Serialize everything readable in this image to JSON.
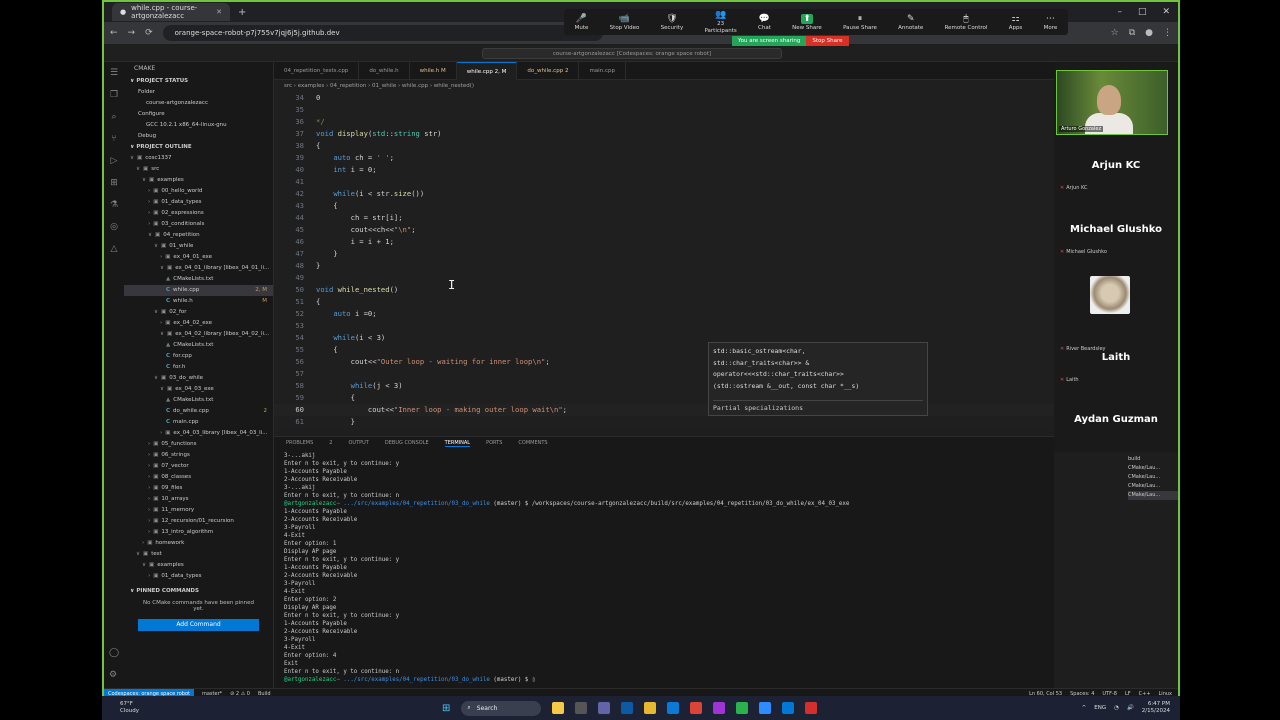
{
  "browser": {
    "tab_title": "while.cpp - course-artgonzalezacc",
    "url": "orange-space-robot-p7j755v7jqj6j5j.github.dev",
    "new_tab": "+",
    "minimize": "–",
    "maximize": "□",
    "close": "✕"
  },
  "zoom": {
    "buttons": [
      {
        "label": "Mute",
        "icon": "🎤"
      },
      {
        "label": "Stop Video",
        "icon": "📹"
      },
      {
        "label": "Security",
        "icon": "🛡"
      },
      {
        "label": "Participants",
        "icon": "👥",
        "count": "23"
      },
      {
        "label": "Chat",
        "icon": "💬"
      },
      {
        "label": "New Share",
        "icon": "⬆"
      },
      {
        "label": "Pause Share",
        "icon": "⏸"
      },
      {
        "label": "Annotate",
        "icon": "✎"
      },
      {
        "label": "Remote Control",
        "icon": "🖱"
      },
      {
        "label": "Apps",
        "icon": "⚏"
      },
      {
        "label": "More",
        "icon": "⋯"
      }
    ],
    "sharing_msg": "You are screen sharing",
    "stop_share": "Stop Share"
  },
  "vscode": {
    "command_center": "course-artgonzalezacc [Codespaces: orange space robot]",
    "sidebar_header": "CMAKE",
    "project_status": "PROJECT STATUS",
    "status_items": [
      "Folder",
      "course-artgonzalezacc",
      "Configure",
      "GCC 10.2.1 x86_64-linux-gnu",
      "Debug"
    ],
    "project_outline": "PROJECT OUTLINE",
    "tree": [
      {
        "label": "cosc1337",
        "indent": 6,
        "chev": "∨"
      },
      {
        "label": "src",
        "indent": 12,
        "chev": "∨"
      },
      {
        "label": "examples",
        "indent": 18,
        "chev": "∨"
      },
      {
        "label": "00_hello_world",
        "indent": 24,
        "chev": "›"
      },
      {
        "label": "01_data_types",
        "indent": 24,
        "chev": "›"
      },
      {
        "label": "02_expressions",
        "indent": 24,
        "chev": "›"
      },
      {
        "label": "03_conditionals",
        "indent": 24,
        "chev": "›"
      },
      {
        "label": "04_repetition",
        "indent": 24,
        "chev": "∨"
      },
      {
        "label": "01_while",
        "indent": 30,
        "chev": "∨"
      },
      {
        "label": "ex_04_01_exe",
        "indent": 36,
        "chev": "›"
      },
      {
        "label": "ex_04_01_library [libex_04_01_li...",
        "indent": 36,
        "chev": "∨"
      },
      {
        "label": "CMakeLists.txt",
        "indent": 42,
        "kind": "cmake"
      },
      {
        "label": "while.cpp",
        "indent": 42,
        "kind": "c",
        "badge": "2, M",
        "selected": true
      },
      {
        "label": "while.h",
        "indent": 42,
        "kind": "c",
        "badge": "M"
      },
      {
        "label": "02_for",
        "indent": 30,
        "chev": "∨"
      },
      {
        "label": "ex_04_02_exe",
        "indent": 36,
        "chev": "›"
      },
      {
        "label": "ex_04_02_library [libex_04_02_li...",
        "indent": 36,
        "chev": "∨"
      },
      {
        "label": "CMakeLists.txt",
        "indent": 42,
        "kind": "cmake"
      },
      {
        "label": "for.cpp",
        "indent": 42,
        "kind": "c"
      },
      {
        "label": "for.h",
        "indent": 42,
        "kind": "c"
      },
      {
        "label": "03_do_while",
        "indent": 30,
        "chev": "∨"
      },
      {
        "label": "ex_04_03_exe",
        "indent": 36,
        "chev": "∨"
      },
      {
        "label": "CMakeLists.txt",
        "indent": 42,
        "kind": "cmake"
      },
      {
        "label": "do_while.cpp",
        "indent": 42,
        "kind": "c",
        "badge": "2"
      },
      {
        "label": "main.cpp",
        "indent": 42,
        "kind": "c"
      },
      {
        "label": "ex_04_03_library [libex_04_03_li...",
        "indent": 36,
        "chev": "›"
      },
      {
        "label": "05_functions",
        "indent": 24,
        "chev": "›"
      },
      {
        "label": "06_strings",
        "indent": 24,
        "chev": "›"
      },
      {
        "label": "07_vector",
        "indent": 24,
        "chev": "›"
      },
      {
        "label": "08_classes",
        "indent": 24,
        "chev": "›"
      },
      {
        "label": "09_files",
        "indent": 24,
        "chev": "›"
      },
      {
        "label": "10_arrays",
        "indent": 24,
        "chev": "›"
      },
      {
        "label": "11_memory",
        "indent": 24,
        "chev": "›"
      },
      {
        "label": "12_recursion/01_recursion",
        "indent": 24,
        "chev": "›"
      },
      {
        "label": "13_intro_algorithm",
        "indent": 24,
        "chev": "›"
      },
      {
        "label": "homework",
        "indent": 18,
        "chev": "›"
      },
      {
        "label": "test",
        "indent": 12,
        "chev": "∨"
      },
      {
        "label": "examples",
        "indent": 18,
        "chev": "∨"
      },
      {
        "label": "01_data_types",
        "indent": 24,
        "chev": "›"
      }
    ],
    "pinned_commands": "PINNED COMMANDS",
    "pinned_note": "No CMake commands have been pinned yet.",
    "add_command": "Add Command",
    "editor_tabs": [
      {
        "label": "04_repetition_tests.cpp",
        "state": ""
      },
      {
        "label": "do_while.h",
        "state": ""
      },
      {
        "label": "while.h  M",
        "state": "mod"
      },
      {
        "label": "while.cpp  2, M",
        "state": "active"
      },
      {
        "label": "do_while.cpp  2",
        "state": "mod"
      },
      {
        "label": "main.cpp",
        "state": ""
      }
    ],
    "breadcrumbs": "src › examples › 04_repetition › 01_while › while.cpp › while_nested()",
    "hover_code": "std::basic_ostream<char,\nstd::char_traits<char>> &\noperator<<<std::char_traits<char>>\n(std::ostream &__out, const char *__s)",
    "hover_sub": "Partial specializations",
    "panel_tabs": [
      "PROBLEMS",
      "OUTPUT",
      "DEBUG CONSOLE",
      "TERMINAL",
      "PORTS",
      "COMMENTS"
    ],
    "problems_count": "2"
  },
  "terminal": [
    {
      "t": "3-...akij"
    },
    {
      "t": "Enter n to exit, y to continue: y"
    },
    {
      "t": "1-Accounts Payable"
    },
    {
      "t": "2-Accounts Receivable"
    },
    {
      "t": "3-...akij"
    },
    {
      "t": "Enter n to exit, y to continue: n"
    },
    {
      "prompt": true,
      "user": "@artgonzalezacc",
      "path": "→ .../src/examples/04_repetition/03_do_while",
      "branch": " (master)",
      "cmd": " $ /workspaces/course-artgonzalezacc/build/src/examples/04_repetition/03_do_while/ex_04_03_exe"
    },
    {
      "t": "1-Accounts Payable"
    },
    {
      "t": "2-Accounts Receivable"
    },
    {
      "t": "3-Payroll"
    },
    {
      "t": "4-Exit"
    },
    {
      "t": "Enter option: 1"
    },
    {
      "t": "Display AP page"
    },
    {
      "t": "Enter n to exit, y to continue: y"
    },
    {
      "t": "1-Accounts Payable"
    },
    {
      "t": "2-Accounts Receivable"
    },
    {
      "t": "3-Payroll"
    },
    {
      "t": "4-Exit"
    },
    {
      "t": "Enter option: 2"
    },
    {
      "t": "Display AR page"
    },
    {
      "t": "Enter n to exit, y to continue: y"
    },
    {
      "t": "1-Accounts Payable"
    },
    {
      "t": "2-Accounts Receivable"
    },
    {
      "t": "3-Payroll"
    },
    {
      "t": "4-Exit"
    },
    {
      "t": "Enter option: 4"
    },
    {
      "t": "Exit"
    },
    {
      "t": "Enter n to exit, y to continue: n"
    },
    {
      "prompt": true,
      "user": "@artgonzalezacc",
      "path": "→ .../src/examples/04_repetition/03_do_while",
      "branch": " (master)",
      "cmd": " $ ▯"
    }
  ],
  "meeting": {
    "host": "Arturo Gonzalez",
    "participants": [
      {
        "big": "Arjun KC",
        "small": "Arjun KC"
      },
      {
        "big": "Michael Glushko",
        "small": "Michael Glushko"
      },
      {
        "big": "",
        "small": "River Beardsley"
      },
      {
        "big": "Laith",
        "small": "Laith"
      },
      {
        "big": "Aydan Guzman",
        "small": ""
      }
    ]
  },
  "mini_list": [
    "build",
    "CMake/Lau...",
    "CMake/Lau...",
    "CMake/Lau...",
    "CMake/Lau..."
  ],
  "status": {
    "remote": "Codespaces: orange space robot",
    "branch": "master*",
    "errors": "⊘ 2 ⚠ 0",
    "build": "Build",
    "right": [
      "Ln 60, Col 53",
      "Spaces: 4",
      "UTF-8",
      "LF",
      "C++",
      "Linux"
    ]
  },
  "taskbar": {
    "temp": "67°F",
    "weather": "Cloudy",
    "search": "Search",
    "lang": "ENG",
    "time": "6:47 PM",
    "date": "2/15/2024"
  }
}
